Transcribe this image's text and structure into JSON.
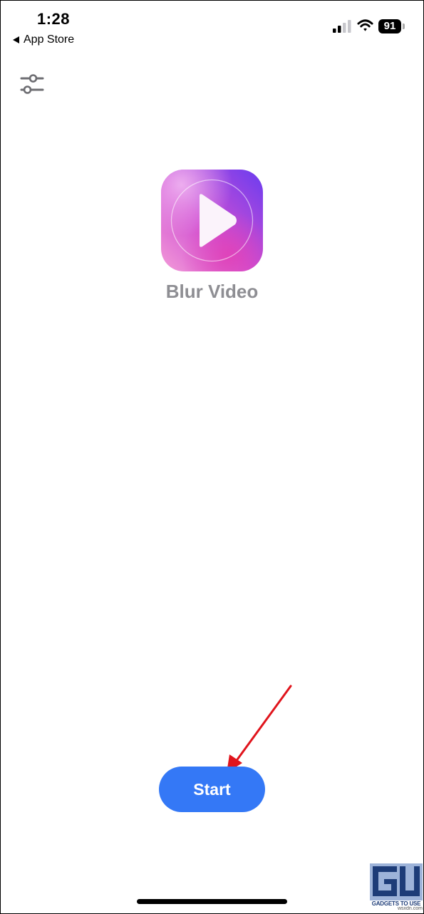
{
  "status_bar": {
    "time": "1:28",
    "back_app": "App Store",
    "battery": "91",
    "icons": [
      "signal-icon",
      "wifi-icon",
      "battery-icon"
    ]
  },
  "toolbar": {
    "settings_icon": "sliders-icon"
  },
  "app": {
    "name": "Blur Video",
    "icon": "play-icon"
  },
  "actions": {
    "start_label": "Start"
  },
  "colors": {
    "accent": "#3478f6",
    "app_name": "#8e8e93",
    "annotation_arrow": "#e0141c",
    "watermark": "#1d3c78"
  },
  "watermark": {
    "brand": "GADGETS TO USE",
    "site": "wsxdn.com"
  }
}
